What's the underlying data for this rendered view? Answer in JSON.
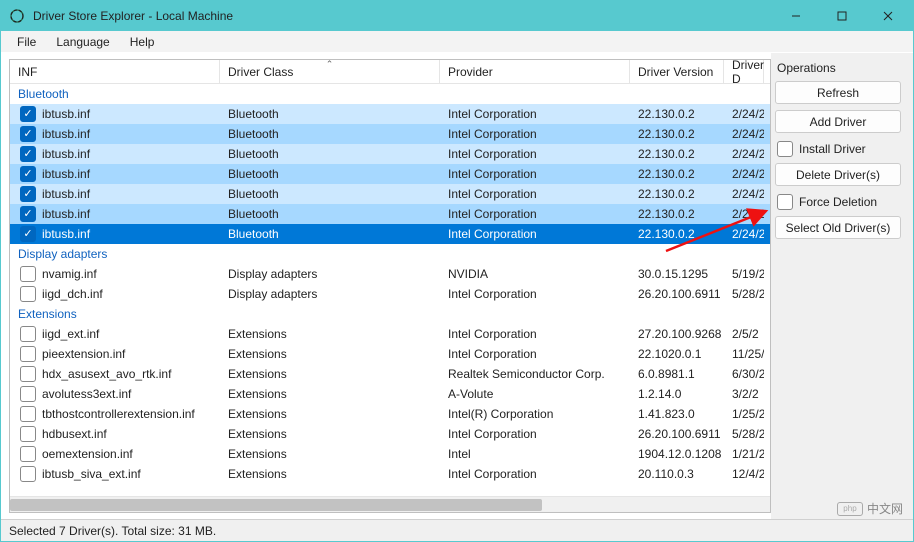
{
  "titlebar": {
    "title": "Driver Store Explorer - Local Machine"
  },
  "menu": {
    "file": "File",
    "language": "Language",
    "help": "Help"
  },
  "columns": {
    "inf": "INF",
    "class": "Driver Class",
    "provider": "Provider",
    "version": "Driver Version",
    "date": "Driver D"
  },
  "groups": [
    {
      "name": "Bluetooth",
      "rows": [
        {
          "checked": true,
          "sel": "light",
          "inf": "ibtusb.inf",
          "class": "Bluetooth",
          "provider": "Intel Corporation",
          "version": "22.130.0.2",
          "date": "2/24/2"
        },
        {
          "checked": true,
          "sel": "medium",
          "inf": "ibtusb.inf",
          "class": "Bluetooth",
          "provider": "Intel Corporation",
          "version": "22.130.0.2",
          "date": "2/24/2"
        },
        {
          "checked": true,
          "sel": "light",
          "inf": "ibtusb.inf",
          "class": "Bluetooth",
          "provider": "Intel Corporation",
          "version": "22.130.0.2",
          "date": "2/24/2"
        },
        {
          "checked": true,
          "sel": "medium",
          "inf": "ibtusb.inf",
          "class": "Bluetooth",
          "provider": "Intel Corporation",
          "version": "22.130.0.2",
          "date": "2/24/2"
        },
        {
          "checked": true,
          "sel": "light",
          "inf": "ibtusb.inf",
          "class": "Bluetooth",
          "provider": "Intel Corporation",
          "version": "22.130.0.2",
          "date": "2/24/2"
        },
        {
          "checked": true,
          "sel": "medium",
          "inf": "ibtusb.inf",
          "class": "Bluetooth",
          "provider": "Intel Corporation",
          "version": "22.130.0.2",
          "date": "2/24/2"
        },
        {
          "checked": true,
          "sel": "dark",
          "inf": "ibtusb.inf",
          "class": "Bluetooth",
          "provider": "Intel Corporation",
          "version": "22.130.0.2",
          "date": "2/24/2"
        }
      ]
    },
    {
      "name": "Display adapters",
      "rows": [
        {
          "checked": false,
          "sel": "none",
          "inf": "nvamig.inf",
          "class": "Display adapters",
          "provider": "NVIDIA",
          "version": "30.0.15.1295",
          "date": "5/19/2"
        },
        {
          "checked": false,
          "sel": "none",
          "inf": "iigd_dch.inf",
          "class": "Display adapters",
          "provider": "Intel Corporation",
          "version": "26.20.100.6911",
          "date": "5/28/2"
        }
      ]
    },
    {
      "name": "Extensions",
      "rows": [
        {
          "checked": false,
          "sel": "none",
          "inf": "iigd_ext.inf",
          "class": "Extensions",
          "provider": "Intel Corporation",
          "version": "27.20.100.9268",
          "date": "2/5/2"
        },
        {
          "checked": false,
          "sel": "none",
          "inf": "pieextension.inf",
          "class": "Extensions",
          "provider": "Intel Corporation",
          "version": "22.1020.0.1",
          "date": "11/25/2"
        },
        {
          "checked": false,
          "sel": "none",
          "inf": "hdx_asusext_avo_rtk.inf",
          "class": "Extensions",
          "provider": "Realtek Semiconductor Corp.",
          "version": "6.0.8981.1",
          "date": "6/30/2"
        },
        {
          "checked": false,
          "sel": "none",
          "inf": "avolutess3ext.inf",
          "class": "Extensions",
          "provider": "A-Volute",
          "version": "1.2.14.0",
          "date": "3/2/2"
        },
        {
          "checked": false,
          "sel": "none",
          "inf": "tbthostcontrollerextension.inf",
          "class": "Extensions",
          "provider": "Intel(R) Corporation",
          "version": "1.41.823.0",
          "date": "1/25/2"
        },
        {
          "checked": false,
          "sel": "none",
          "inf": "hdbusext.inf",
          "class": "Extensions",
          "provider": "Intel Corporation",
          "version": "26.20.100.6911",
          "date": "5/28/2"
        },
        {
          "checked": false,
          "sel": "none",
          "inf": "oemextension.inf",
          "class": "Extensions",
          "provider": "Intel",
          "version": "1904.12.0.1208",
          "date": "1/21/2"
        },
        {
          "checked": false,
          "sel": "none",
          "inf": "ibtusb_siva_ext.inf",
          "class": "Extensions",
          "provider": "Intel Corporation",
          "version": "20.110.0.3",
          "date": "12/4/2"
        }
      ]
    }
  ],
  "sidebar": {
    "title": "Operations",
    "refresh": "Refresh",
    "addDriver": "Add Driver",
    "installDriver": "Install Driver",
    "deleteDrivers": "Delete Driver(s)",
    "forceDeletion": "Force Deletion",
    "selectOld": "Select Old Driver(s)"
  },
  "status": {
    "text": "Selected 7 Driver(s). Total size: 31 MB."
  },
  "watermark": {
    "text": "中文网"
  }
}
